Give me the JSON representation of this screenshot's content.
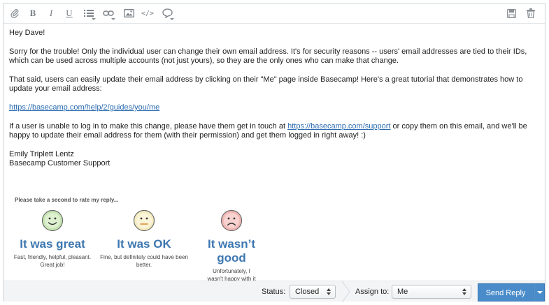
{
  "message": {
    "greeting": "Hey Dave!",
    "para1": "Sorry for the trouble! Only the individual user can change their own email address. It's for security reasons -- users' email addresses are tied to their IDs, which can be used across multiple accounts (not just yours), so they are the only ones who can make that change.",
    "para2": "That said, users can easily update their email address by clicking on their \"Me\" page inside Basecamp! Here's a great tutorial that demonstrates how to update your email address:",
    "link1": "https://basecamp.com/help/2/guides/you/me",
    "para3_before": "If a user is unable to log in to make this change, please have them get in touch at ",
    "link2": "https://basecamp.com/support",
    "para3_after": " or copy them on this email, and we'll be happy to update their email address for them (with their permission) and get them logged in right away! :)",
    "signature_name": "Emily Triplett Lentz",
    "signature_role": "Basecamp Customer Support"
  },
  "rating": {
    "prompt": "Please take a second to rate my reply...",
    "options": [
      {
        "title": "It was great",
        "desc": "Fast, friendly, helpful, pleasant. Great job!",
        "face": "smile-face-icon",
        "color": "#c8e6b4"
      },
      {
        "title": "It was OK",
        "desc": "Fine, but definitely could have been better.",
        "face": "neutral-face-icon",
        "color": "#f5ecc0"
      },
      {
        "title": "It wasn’t good",
        "desc": "Unfortunately, I wasn't happy with it at all.",
        "face": "frown-face-icon",
        "color": "#f2b9b6"
      }
    ]
  },
  "footer": {
    "status_label": "Status:",
    "status_value": "Closed",
    "assign_label": "Assign to:",
    "assign_value": "Me",
    "send_label": "Send Reply"
  },
  "toolbar": {
    "icons": [
      "attachment-icon",
      "bold-icon",
      "italic-icon",
      "underline-icon",
      "list-icon",
      "link-icon",
      "image-icon",
      "code-icon",
      "comment-icon",
      "save-icon",
      "trash-icon"
    ]
  },
  "colors": {
    "accent": "#4a8cc9",
    "rating_title": "#3d77b0",
    "link": "#2b6cb0"
  }
}
